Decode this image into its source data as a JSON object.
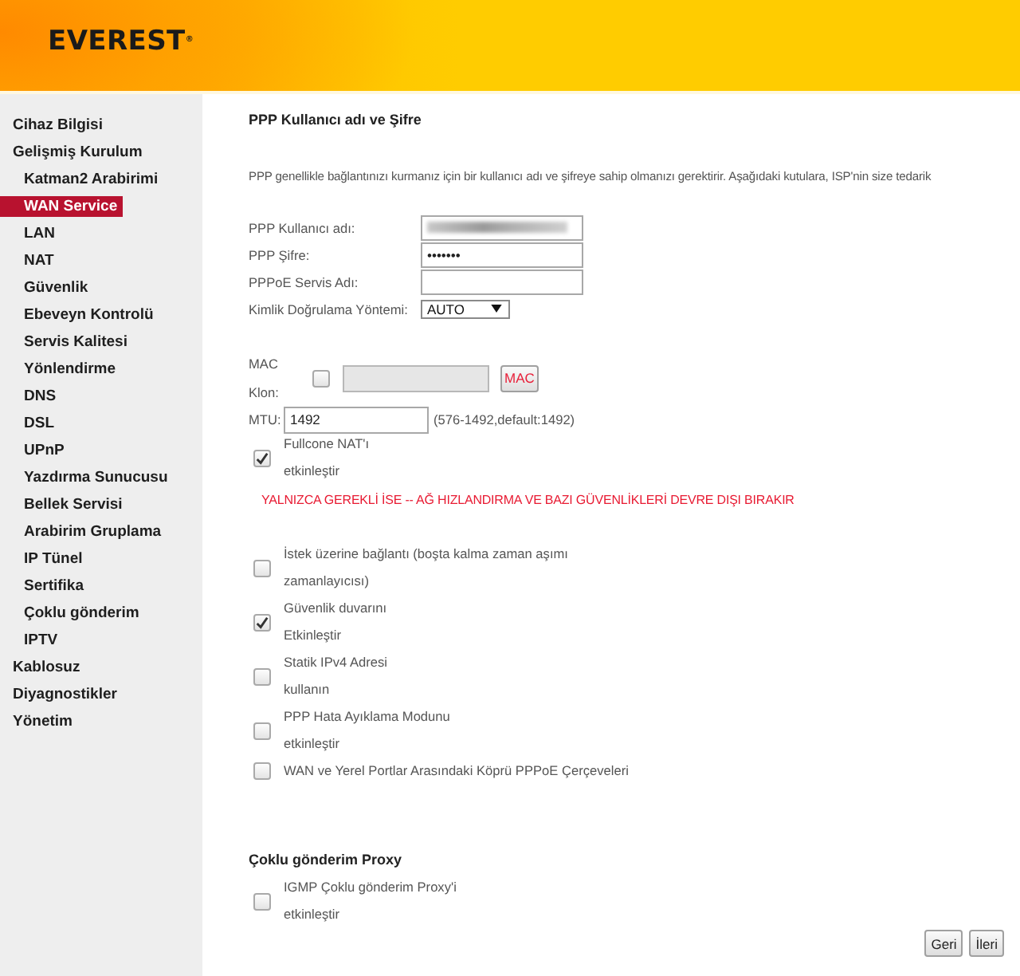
{
  "header": {
    "logo": "EVEREST$^{®}$"
  },
  "sidebar": {
    "items": [
      {
        "label": "Cihaz Bilgisi",
        "selected": false
      },
      {
        "label": "Gelişmiş Kurulum",
        "selected": false,
        "children": [
          {
            "label": "Katman2 Arabirimi",
            "selected": false
          },
          {
            "label": "WAN Service",
            "selected": true
          },
          {
            "label": "LAN",
            "selected": false
          },
          {
            "label": "NAT",
            "selected": false
          },
          {
            "label": "Güvenlik",
            "selected": false
          },
          {
            "label": "Ebeveyn Kontrolü",
            "selected": false
          },
          {
            "label": "Servis Kalitesi",
            "selected": false
          },
          {
            "label": "Yönlendirme",
            "selected": false
          },
          {
            "label": "DNS",
            "selected": false
          },
          {
            "label": "DSL",
            "selected": false
          },
          {
            "label": "UPnP",
            "selected": false
          },
          {
            "label": "Yazdırma Sunucusu",
            "selected": false
          },
          {
            "label": "Bellek Servisi",
            "selected": false
          },
          {
            "label": "Arabirim Gruplama",
            "selected": false
          },
          {
            "label": "IP Tünel",
            "selected": false
          },
          {
            "label": "Sertifika",
            "selected": false
          },
          {
            "label": "Çoklu gönderim",
            "selected": false
          },
          {
            "label": "IPTV",
            "selected": false
          }
        ]
      },
      {
        "label": "Kablosuz",
        "selected": false
      },
      {
        "label": "Diyagnostikler",
        "selected": false
      },
      {
        "label": "Yönetim",
        "selected": false
      }
    ]
  },
  "main": {
    "title": "PPP Kullanıcı adı ve Şifre",
    "intro": "PPP genellikle bağlantınızı kurmanız için bir kullanıcı adı ve şifreye sahip olmanızı gerektirir. Aşağıdaki kutulara, ISP'nin size tedarik",
    "fields": [
      {
        "kind": "text",
        "label": "PPP Kullanıcı adı:",
        "redacted": true
      },
      {
        "kind": "text",
        "label": "PPP Şifre:",
        "value": "•••••••"
      },
      {
        "kind": "text",
        "label": "PPPoE Servis Adı:"
      },
      {
        "kind": "select",
        "label": "Kimlik Doğrulama Yöntemi:",
        "value": "AUTO"
      }
    ],
    "mac_clone": {
      "label_lines": [
        "MAC",
        "Klon:"
      ],
      "checked": false,
      "disabled": true,
      "button": "MAC"
    },
    "mtu": {
      "label": "MTU:",
      "value": "1492",
      "hint": "(576-1492,default:1492)"
    },
    "fullcone": {
      "label_lines": [
        "Fullcone NAT'ı",
        "etkinleştir"
      ],
      "checked": true
    },
    "warning": "YALNIZCA GEREKLİ İSE -- AĞ HIZLANDIRMA VE BAZI GÜVENLİKLERİ DEVRE DIŞI BIRAKIR",
    "options": [
      {
        "label_lines": [
          "İstek üzerine bağlantı (boşta kalma zaman aşımı",
          "zamanlayıcısı)"
        ],
        "checked": false
      },
      {
        "label_lines": [
          "Güvenlik duvarını",
          "Etkinleştir"
        ],
        "checked": true
      },
      {
        "label_lines": [
          "Statik IPv4 Adresi",
          "kullanın"
        ],
        "checked": false
      },
      {
        "label_lines": [
          "PPP Hata Ayıklama Modunu",
          "etkinleştir"
        ],
        "checked": false
      },
      {
        "label_lines": [
          "WAN ve Yerel Portlar Arasındaki Köprü PPPoE Çerçeveleri"
        ],
        "checked": false
      }
    ],
    "proxy": {
      "title": "Çoklu gönderim Proxy",
      "options": [
        {
          "label_lines": [
            "IGMP Çoklu gönderim Proxy'i",
            "etkinleştir"
          ],
          "checked": false
        }
      ]
    },
    "buttons": [
      "Geri",
      "İleri"
    ]
  }
}
